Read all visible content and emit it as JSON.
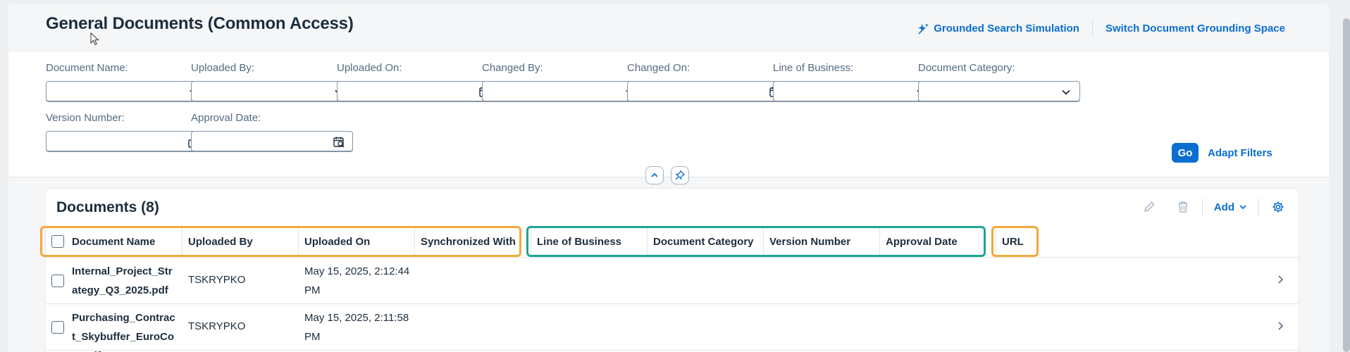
{
  "header": {
    "title": "General Documents (Common Access)",
    "grounded_search": "Grounded Search Simulation",
    "switch_space": "Switch Document Grounding Space"
  },
  "filters": [
    {
      "label": "Document Name:",
      "type": "select"
    },
    {
      "label": "Uploaded By:",
      "type": "select"
    },
    {
      "label": "Uploaded On:",
      "type": "date"
    },
    {
      "label": "Changed By:",
      "type": "select"
    },
    {
      "label": "Changed On:",
      "type": "date"
    },
    {
      "label": "Line of Business:",
      "type": "select"
    },
    {
      "label": "Document Category:",
      "type": "select"
    },
    {
      "label": "Version Number:",
      "type": "valuehelp"
    },
    {
      "label": "Approval Date:",
      "type": "date"
    }
  ],
  "filterbar": {
    "go": "Go",
    "adapt": "Adapt Filters"
  },
  "table": {
    "title": "Documents (8)",
    "add": "Add",
    "columns": [
      "Document Name",
      "Uploaded By",
      "Uploaded On",
      "Synchronized With",
      "Line of Business",
      "Document Category",
      "Version Number",
      "Approval Date",
      "URL"
    ],
    "rows": [
      {
        "name": "Internal_Project_Strategy_Q3_2025.pdf",
        "uploaded_by": "TSKRYPKO",
        "uploaded_on": "May 15, 2025, 2:12:44 PM"
      },
      {
        "name": "Purchasing_Contract_Skybuffer_EuroCoat.pdf",
        "uploaded_by": "TSKRYPKO",
        "uploaded_on": "May 15, 2025, 2:11:58 PM"
      }
    ]
  },
  "colors": {
    "accent": "#0a6ed1",
    "highlight_orange": "#f2a93b",
    "highlight_teal": "#1fa590"
  }
}
